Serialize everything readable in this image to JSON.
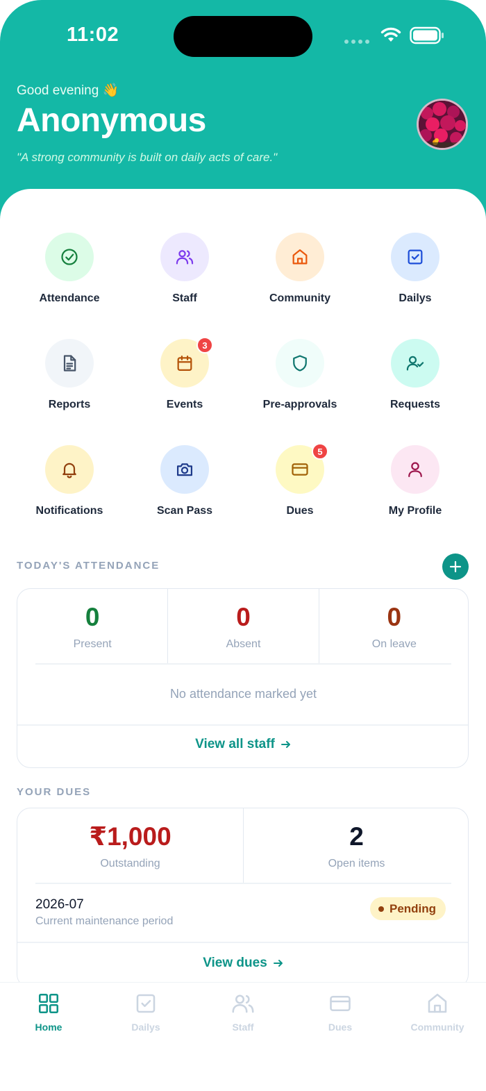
{
  "status_bar": {
    "time": "11:02"
  },
  "header": {
    "greeting": "Good evening 👋",
    "name": "Anonymous",
    "quote": "\"A strong community is built on daily acts of care.\""
  },
  "quick_actions": [
    {
      "label": "Attendance",
      "icon": "check-circle-icon",
      "bg": "#dcfce7",
      "fg": "#15803d"
    },
    {
      "label": "Staff",
      "icon": "users-icon",
      "bg": "#ede9fe",
      "fg": "#7c3aed"
    },
    {
      "label": "Community",
      "icon": "home-icon",
      "bg": "#ffedd5",
      "fg": "#ea580c"
    },
    {
      "label": "Dailys",
      "icon": "check-square-icon",
      "bg": "#dbeafe",
      "fg": "#1d4ed8"
    },
    {
      "label": "Reports",
      "icon": "file-text-icon",
      "bg": "#f1f5f9",
      "fg": "#475569"
    },
    {
      "label": "Events",
      "icon": "calendar-icon",
      "bg": "#fef3c7",
      "fg": "#b45309",
      "badge": "3"
    },
    {
      "label": "Pre-approvals",
      "icon": "shield-icon",
      "bg": "#f0fdfa",
      "fg": "#0f766e"
    },
    {
      "label": "Requests",
      "icon": "user-check-icon",
      "bg": "#ccfbf1",
      "fg": "#0f766e"
    },
    {
      "label": "Notifications",
      "icon": "bell-icon",
      "bg": "#fef3c7",
      "fg": "#92400e"
    },
    {
      "label": "Scan Pass",
      "icon": "camera-icon",
      "bg": "#dbeafe",
      "fg": "#1e3a8a"
    },
    {
      "label": "Dues",
      "icon": "credit-card-icon",
      "bg": "#fef9c3",
      "fg": "#a16207",
      "badge": "5"
    },
    {
      "label": "My Profile",
      "icon": "user-icon",
      "bg": "#fce7f3",
      "fg": "#9d174d"
    }
  ],
  "attendance": {
    "title": "TODAY'S ATTENDANCE",
    "present_value": "0",
    "present_label": "Present",
    "absent_value": "0",
    "absent_label": "Absent",
    "leave_value": "0",
    "leave_label": "On leave",
    "empty": "No attendance marked yet",
    "link": "View all staff",
    "colors": {
      "present": "#15803d",
      "absent": "#b91c1c",
      "leave": "#9a3412"
    }
  },
  "dues": {
    "title": "YOUR DUES",
    "outstanding_value": "₹1,000",
    "outstanding_label": "Outstanding",
    "open_value": "2",
    "open_label": "Open items",
    "period": "2026-07",
    "period_label": "Current maintenance period",
    "status": "Pending",
    "link": "View dues"
  },
  "tabbar": [
    {
      "label": "Home",
      "icon": "grid-icon",
      "active": true
    },
    {
      "label": "Dailys",
      "icon": "check-square-icon",
      "active": false
    },
    {
      "label": "Staff",
      "icon": "users-icon",
      "active": false
    },
    {
      "label": "Dues",
      "icon": "credit-card-icon",
      "active": false
    },
    {
      "label": "Community",
      "icon": "home-icon",
      "active": false
    }
  ],
  "accent": "#14b8a6"
}
